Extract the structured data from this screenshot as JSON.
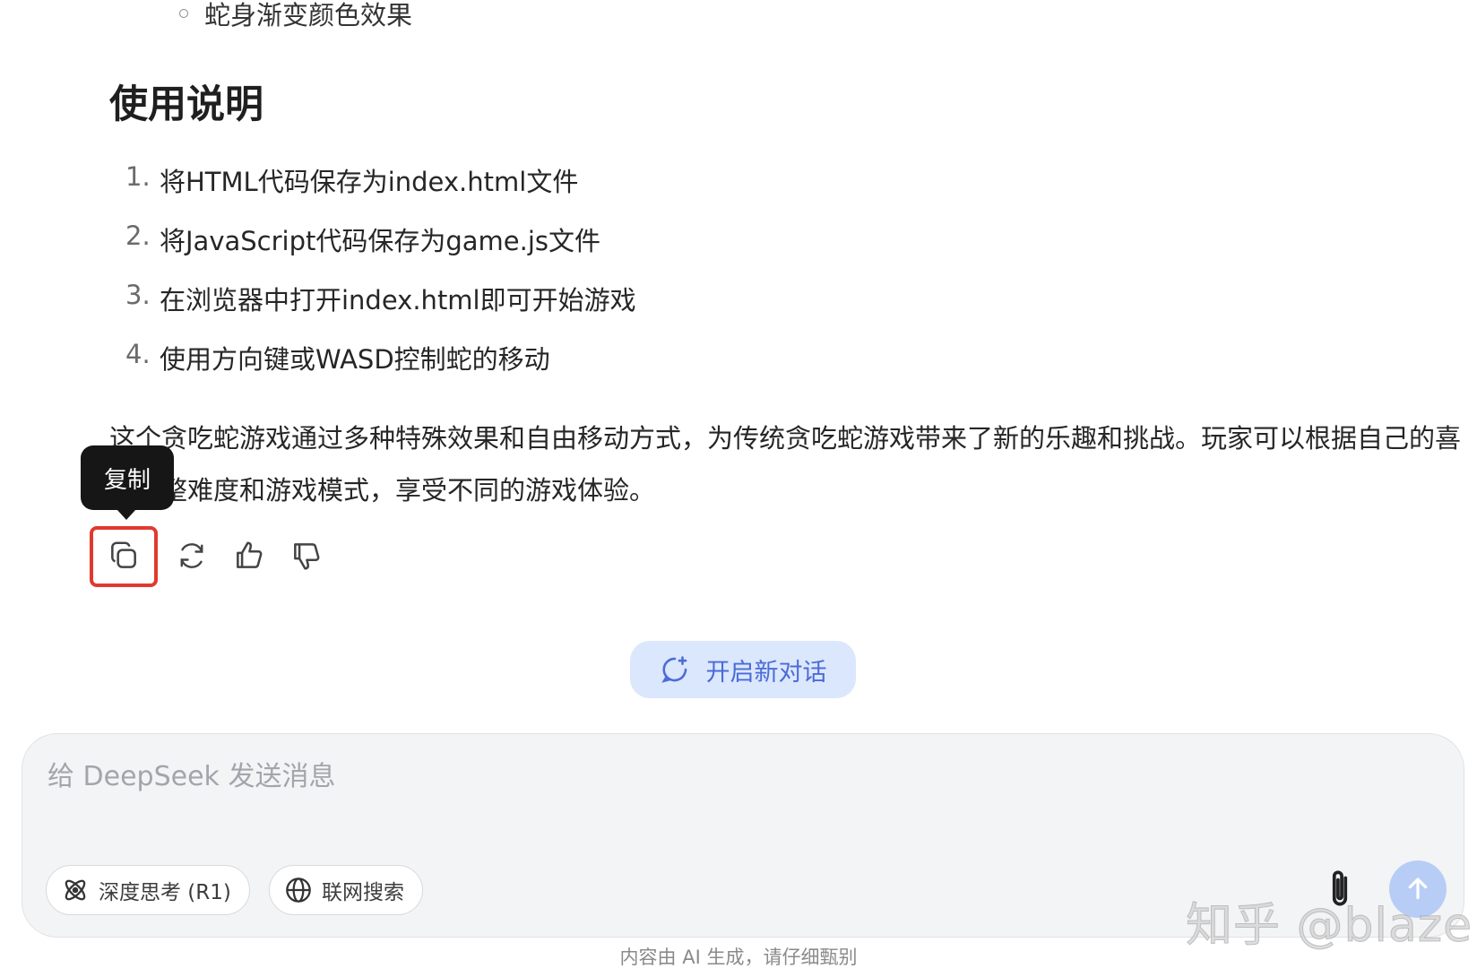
{
  "content": {
    "sub_bullet": "蛇身渐变颜色效果",
    "section_title": "使用说明",
    "steps": [
      {
        "num": "1.",
        "text": "将HTML代码保存为index.html文件"
      },
      {
        "num": "2.",
        "text": "将JavaScript代码保存为game.js文件"
      },
      {
        "num": "3.",
        "text": "在浏览器中打开index.html即可开始游戏"
      },
      {
        "num": "4.",
        "text": "使用方向键或WASD控制蛇的移动"
      }
    ],
    "paragraph": "这个贪吃蛇游戏通过多种特殊效果和自由移动方式，为传统贪吃蛇游戏带来了新的乐趣和挑战。玩家可以根据自己的喜好调整难度和游戏模式，享受不同的游戏体验。"
  },
  "tooltip": "复制",
  "actions": [
    {
      "name": "copy-icon"
    },
    {
      "name": "regenerate-icon"
    },
    {
      "name": "thumbs-up-icon"
    },
    {
      "name": "thumbs-down-icon"
    }
  ],
  "new_chat_label": "开启新对话",
  "composer": {
    "placeholder": "给 DeepSeek 发送消息",
    "deep_think_label": "深度思考 (R1)",
    "web_search_label": "联网搜索"
  },
  "watermark": "知乎 @blaze",
  "disclaimer": "内容由 AI 生成，请仔细甄别",
  "colors": {
    "accent": "#4b6bd6",
    "new_chat_bg": "#dbe7fd",
    "highlight_box": "#e03a2e",
    "send_button": "#b8cdf6"
  }
}
